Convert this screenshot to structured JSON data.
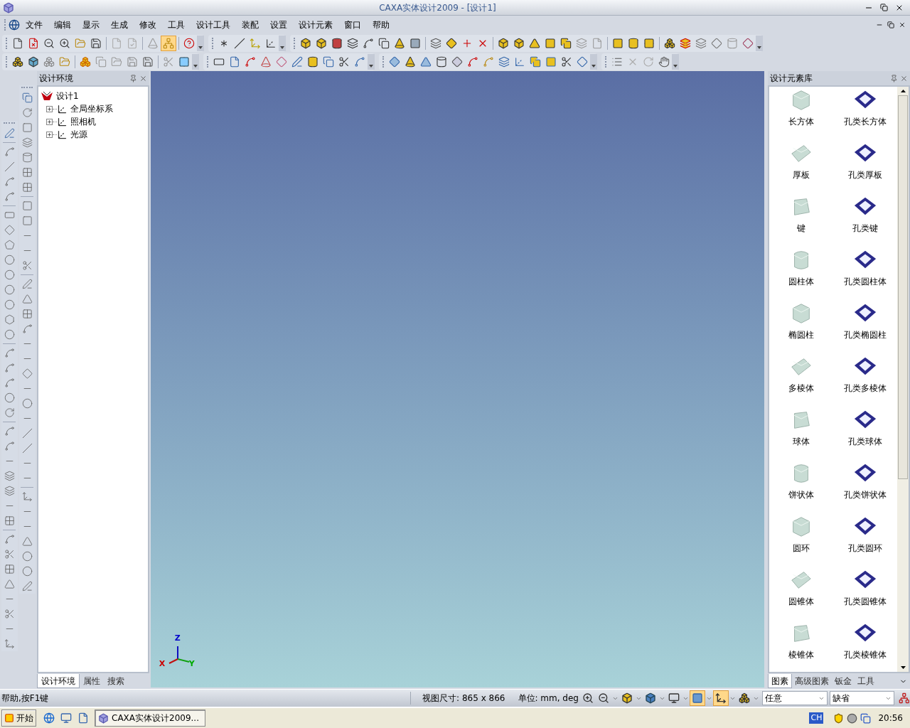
{
  "window": {
    "title": "CAXA实体设计2009 - [设计1]"
  },
  "menu": [
    "文件",
    "编辑",
    "显示",
    "生成",
    "修改",
    "工具",
    "设计工具",
    "装配",
    "设置",
    "设计元素",
    "窗口",
    "帮助"
  ],
  "standard_toolbar": {
    "buttons": [
      {
        "selected": false
      },
      {
        "selected": false
      },
      {
        "selected": false
      },
      {
        "selected": false
      },
      {
        "selected": false
      },
      {
        "selected": false
      },
      {
        "selected": false
      },
      {
        "selected": false
      },
      {
        "selected": false
      },
      {
        "selected": true
      },
      {
        "selected": false
      }
    ]
  },
  "left_panel": {
    "title": "设计环境",
    "tree": [
      {
        "label": "设计1",
        "children": [
          {
            "label": "全局坐标系",
            "expanded": false
          },
          {
            "label": "照相机",
            "expanded": false
          },
          {
            "label": "光源",
            "expanded": false
          }
        ]
      }
    ],
    "tabs": [
      {
        "label": "设计环境",
        "selected": true
      },
      {
        "label": "属性",
        "selected": false
      },
      {
        "label": "搜索",
        "selected": false
      }
    ]
  },
  "viewport": {
    "axes": [
      {
        "label": "Z",
        "color": "#0000cc"
      },
      {
        "label": "X",
        "color": "#cc0000"
      },
      {
        "label": "Y",
        "color": "#00aa00"
      }
    ]
  },
  "right_panel": {
    "title": "设计元素库",
    "items": [
      {
        "label": "长方体",
        "kind": "solid"
      },
      {
        "label": "孔类长方体",
        "kind": "hole"
      },
      {
        "label": "厚板",
        "kind": "solid"
      },
      {
        "label": "孔类厚板",
        "kind": "hole"
      },
      {
        "label": "键",
        "kind": "solid"
      },
      {
        "label": "孔类键",
        "kind": "hole"
      },
      {
        "label": "圆柱体",
        "kind": "solid"
      },
      {
        "label": "孔类圆柱体",
        "kind": "hole"
      },
      {
        "label": "椭圆柱",
        "kind": "solid"
      },
      {
        "label": "孔类椭圆柱",
        "kind": "hole"
      },
      {
        "label": "多棱体",
        "kind": "solid"
      },
      {
        "label": "孔类多棱体",
        "kind": "hole"
      },
      {
        "label": "球体",
        "kind": "solid"
      },
      {
        "label": "孔类球体",
        "kind": "hole"
      },
      {
        "label": "饼状体",
        "kind": "solid"
      },
      {
        "label": "孔类饼状体",
        "kind": "hole"
      },
      {
        "label": "圆环",
        "kind": "solid"
      },
      {
        "label": "孔类圆环",
        "kind": "hole"
      },
      {
        "label": "圆锥体",
        "kind": "solid"
      },
      {
        "label": "孔类圆锥体",
        "kind": "hole"
      },
      {
        "label": "棱锥体",
        "kind": "solid"
      },
      {
        "label": "孔类棱锥体",
        "kind": "hole"
      }
    ],
    "tabs": [
      {
        "label": "图素",
        "selected": true
      },
      {
        "label": "高级图素",
        "selected": false
      },
      {
        "label": "钣金",
        "selected": false
      },
      {
        "label": "工具",
        "selected": false
      }
    ]
  },
  "status_bar": {
    "help": "帮助,按F1键",
    "view_size": "视图尺寸: 865 x 866",
    "units": "单位: mm, deg",
    "tools": [
      {
        "selected": false
      },
      {
        "selected": false
      },
      {
        "selected": false
      },
      {
        "selected": false
      },
      {
        "selected": false
      },
      {
        "selected": true
      },
      {
        "selected": true
      },
      {
        "selected": false
      }
    ],
    "dropdowns": [
      {
        "value": "任意"
      },
      {
        "value": "缺省"
      }
    ]
  },
  "taskbar": {
    "start": "开始",
    "tasks": [
      {
        "label": "CAXA实体设计2009...",
        "selected": true
      }
    ],
    "language": "CH",
    "time": "20:56"
  }
}
